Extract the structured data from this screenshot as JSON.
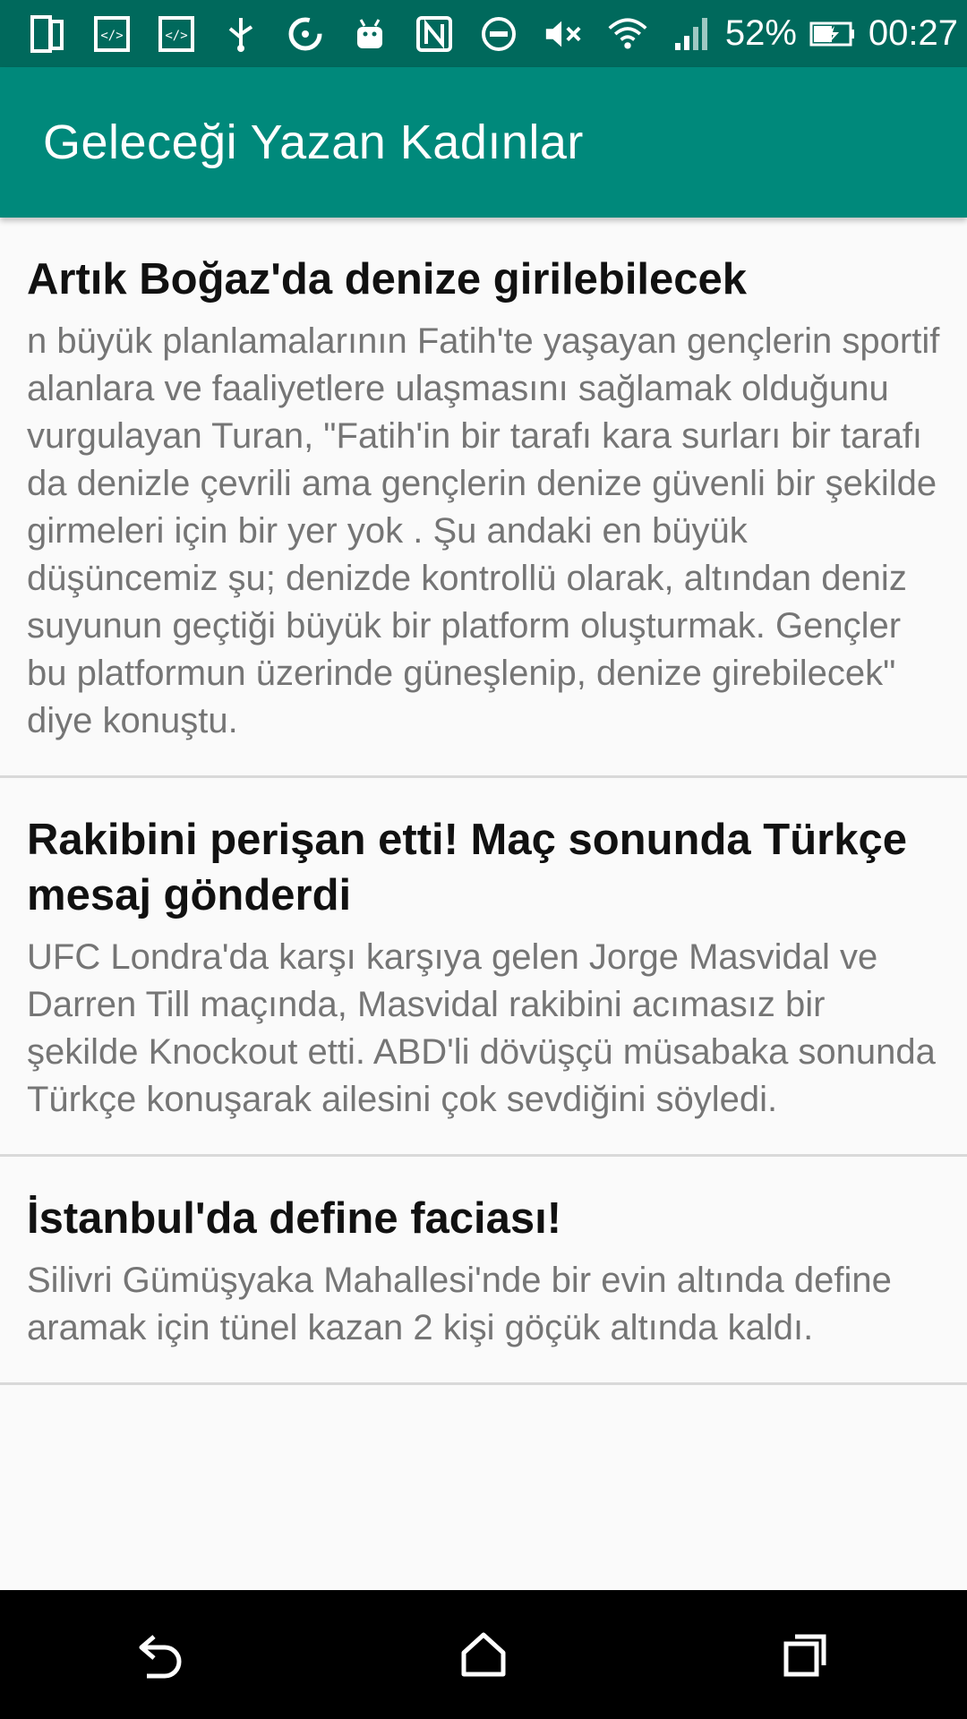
{
  "status_bar": {
    "icons": [
      "sim-card-icon",
      "code-icon",
      "code-icon",
      "usb-icon",
      "sync-icon",
      "android-icon",
      "nfc-icon",
      "do-not-disturb-icon",
      "volume-mute-icon",
      "wifi-icon",
      "signal-icon"
    ],
    "battery_percent": "52%",
    "time": "00:27"
  },
  "app_bar": {
    "title": "Geleceği Yazan Kadınlar"
  },
  "news": [
    {
      "title": "Artık Boğaz'da denize girilebilecek",
      "body": "n büyük planlamalarının Fatih'te yaşayan gençlerin sportif alanlara ve faaliyetlere ulaşmasını sağlamak olduğunu vurgulayan Turan, \"Fatih'in bir tarafı kara surları bir tarafı da denizle çevrili ama gençlerin denize güvenli bir şekilde girmeleri için bir yer yok . Şu andaki en büyük düşüncemiz şu; denizde kontrollü olarak, altından deniz suyunun geçtiği büyük bir platform oluşturmak. Gençler bu platformun üzerinde güneşlenip, denize girebilecek\" diye konuştu."
    },
    {
      "title": "Rakibini perişan etti! Maç sonunda Türkçe mesaj gönderdi",
      "body": "UFC Londra'da karşı karşıya gelen Jorge Masvidal ve Darren Till maçında, Masvidal rakibini acımasız bir şekilde Knockout etti. ABD'li dövüşçü müsabaka sonunda Türkçe konuşarak ailesini çok sevdiğini söyledi."
    },
    {
      "title": "İstanbul'da define faciası!",
      "body": "Silivri Gümüşyaka Mahallesi'nde bir evin altında define aramak için tünel kazan 2 kişi göçük altında kaldı."
    }
  ],
  "nav_bar": {
    "buttons": [
      "back-icon",
      "home-icon",
      "recent-apps-icon"
    ]
  },
  "colors": {
    "status_bar": "#00695c",
    "app_bar": "#00897b",
    "title_text": "#111111",
    "body_text": "#757575"
  }
}
